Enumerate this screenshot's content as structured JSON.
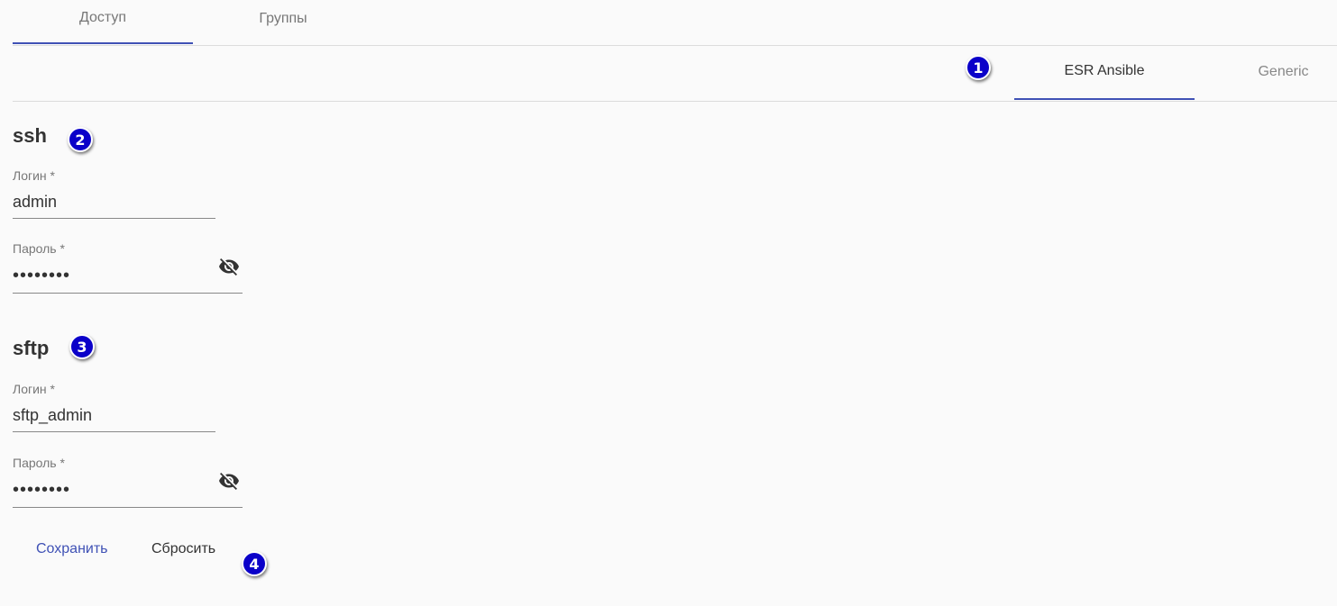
{
  "top_tabs": [
    {
      "label": "Доступ",
      "active": true
    },
    {
      "label": "Группы",
      "active": false
    }
  ],
  "sub_tabs": [
    {
      "label": "ESR Ansible",
      "active": true
    },
    {
      "label": "Generic",
      "active": false
    }
  ],
  "markers": [
    "1",
    "2",
    "3",
    "4"
  ],
  "ssh": {
    "title": "ssh",
    "login_label": "Логин *",
    "login_value": "admin",
    "password_label": "Пароль *",
    "password_value": "••••••••"
  },
  "sftp": {
    "title": "sftp",
    "login_label": "Логин *",
    "login_value": "sftp_admin",
    "password_label": "Пароль *",
    "password_value": "••••••••"
  },
  "buttons": {
    "save": "Сохранить",
    "reset": "Сбросить"
  },
  "icons": {
    "password_toggle": "eye-off-icon"
  },
  "colors": {
    "accent": "#3f51b5",
    "marker": "#0b00c9",
    "background": "#fafafa"
  }
}
